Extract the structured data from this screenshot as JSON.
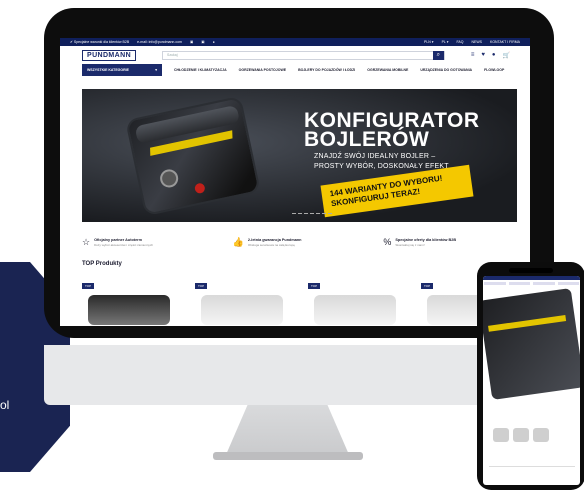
{
  "topbar": {
    "b2b_text": "✔ Specjalne warunki dla klientów B2B",
    "email_text": "e-mail: info@pundmann.com",
    "lang": "PLN ▾",
    "country": "PL ▾",
    "faq": "FAQ",
    "news": "NEWS",
    "contact": "KONTAKT I FIRMA"
  },
  "header": {
    "logo": "PUNDMANN",
    "search_placeholder": "Szukaj"
  },
  "nav": {
    "all_categories": "WSZYSTKIE KATEGORIE",
    "items": [
      "CHŁODZENIE I KLIMATYZACJA",
      "OGRZEWANIA POSTOJOWE",
      "BOJLERY DO POJAZDÓW I ŁODZI",
      "OGRZEWANIA MOBILNE",
      "URZĄDZENIA DO GOTOWANIA",
      "FLOWLOOP"
    ]
  },
  "hero": {
    "title_line1": "KONFIGURATOR",
    "title_line2": "BOJLERÓW",
    "sub_line1": "ZNAJDŹ SWÓJ IDEALNY BOJLER –",
    "sub_line2": "PROSTY WYBÓR, DOSKONAŁY EFEKT",
    "cta_line1": "144 WARIANTY DO WYBORU!",
    "cta_line2": "SKONFIGURUJ TERAZ!"
  },
  "benefits": [
    {
      "icon": "☆",
      "icon_name": "star-icon",
      "title": "Oficjalny partner Autoterm",
      "desc": "Duży wybór akcesoriów i części zamiennych"
    },
    {
      "icon": "👍",
      "icon_name": "thumbs-up-icon",
      "title": "2-letnia gwarancja Pundmann",
      "desc": "Obsługa serwisowa na całą Europę"
    },
    {
      "icon": "%",
      "icon_name": "percent-icon",
      "title": "Specjalne oferty dla klientów B2B",
      "desc": "Skontaktuj się z nami!"
    }
  ],
  "top_products_title": "TOP Produkty",
  "product_tags": [
    "TOP",
    "TOP",
    "TOP",
    "TOP"
  ],
  "hex_text": "ol",
  "colors": {
    "brand": "#1b2a6b",
    "topbar": "#0f1f5c",
    "ribbon": "#f4c800"
  }
}
